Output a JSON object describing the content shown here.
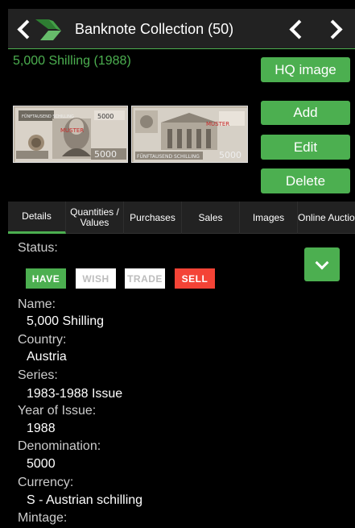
{
  "header": {
    "title": "Banknote Collection (50)"
  },
  "item_title": "5,000 Shilling (1988)",
  "buttons": {
    "hq_image": "HQ image",
    "add": "Add",
    "edit": "Edit",
    "delete": "Delete"
  },
  "banknote_front": {
    "text_top": "FÜNFTAUSEND SCHILLING",
    "text_muster": "MUSTER",
    "denom": "5000"
  },
  "banknote_back": {
    "text_bottom": "FÜNFTAUSEND SCHILLING",
    "text_muster": "MUSTER",
    "denom": "5000"
  },
  "tabs": [
    {
      "label_line1": "Details",
      "label_line2": ""
    },
    {
      "label_line1": "Quantities /",
      "label_line2": "Values"
    },
    {
      "label_line1": "Purchases",
      "label_line2": ""
    },
    {
      "label_line1": "Sales",
      "label_line2": ""
    },
    {
      "label_line1": "Images",
      "label_line2": ""
    },
    {
      "label_line1": "Online Auction",
      "label_line2": ""
    }
  ],
  "status": {
    "label": "Status:",
    "options": [
      {
        "label": "HAVE",
        "color": "#4caf50"
      },
      {
        "label": "WISH",
        "color": "#ffffff"
      },
      {
        "label": "TRADE",
        "color": "#ffffff"
      },
      {
        "label": "SELL",
        "color": "#f44336"
      }
    ]
  },
  "fields": [
    {
      "label": "Name:",
      "value": "5,000 Shilling"
    },
    {
      "label": "Country:",
      "value": "Austria"
    },
    {
      "label": "Series:",
      "value": "1983-1988 Issue"
    },
    {
      "label": "Year of Issue:",
      "value": "1988"
    },
    {
      "label": "Denomination:",
      "value": "5000"
    },
    {
      "label": "Currency:",
      "value": "S - Austrian schilling"
    },
    {
      "label": "Mintage:",
      "value": ""
    }
  ],
  "colors": {
    "accent": "#4caf50",
    "sell": "#f44336",
    "topbar": "#222222"
  }
}
